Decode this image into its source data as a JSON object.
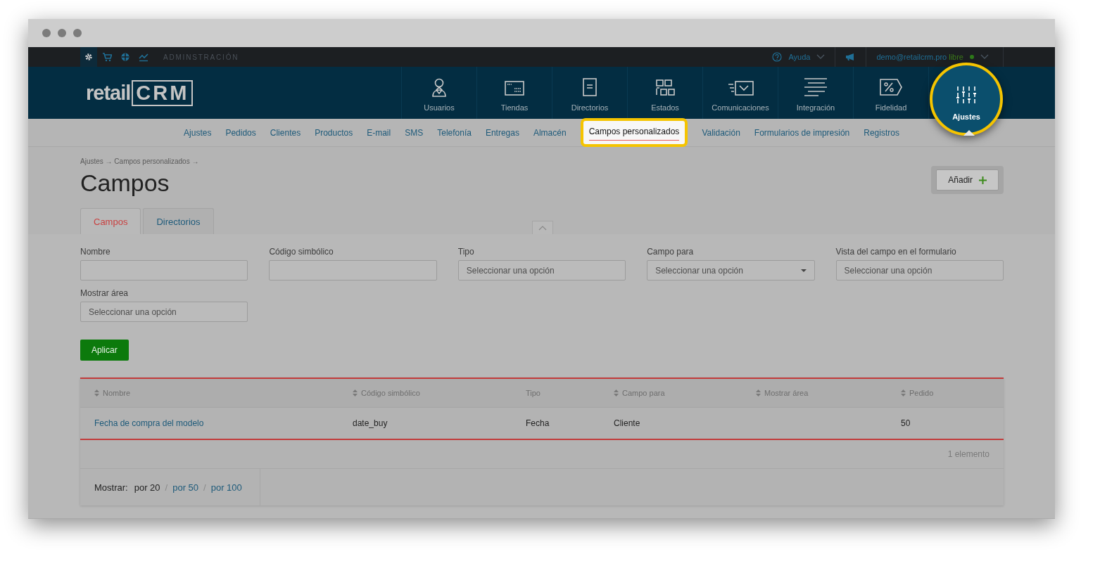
{
  "window": {
    "controls": [
      {
        "kind": "dot"
      },
      {
        "kind": "dot"
      },
      {
        "kind": "dot"
      }
    ]
  },
  "top_bar": {
    "icons": [
      {
        "kind": "gear",
        "selected": true
      },
      {
        "kind": "cart",
        "selected": false
      },
      {
        "kind": "target",
        "selected": false
      },
      {
        "kind": "chart",
        "selected": false
      }
    ],
    "section": "ADMINSTRACIÓN",
    "help": "Ayuda",
    "user": "demo@retailcrm.pro",
    "plan": "libre"
  },
  "logo": {
    "part_1": "retail",
    "part_2": "CRM"
  },
  "main_nav": [
    {
      "label": "Usuarios",
      "kind": "user",
      "selected": false
    },
    {
      "label": "Tiendas",
      "kind": "window",
      "selected": false
    },
    {
      "label": "Directorios",
      "kind": "doc",
      "selected": false
    },
    {
      "label": "Estados",
      "kind": "grid",
      "selected": false
    },
    {
      "label": "Comunicaciones",
      "kind": "mail",
      "selected": false
    },
    {
      "label": "Integración",
      "kind": "lines",
      "selected": false
    },
    {
      "label": "Fidelidad",
      "kind": "percent",
      "selected": false
    },
    {
      "label": "Ajustes",
      "kind": "sliders",
      "selected": true
    }
  ],
  "sub_nav": [
    {
      "label": "Ajustes",
      "selected": false
    },
    {
      "label": "Pedidos",
      "selected": false
    },
    {
      "label": "Clientes",
      "selected": false
    },
    {
      "label": "Productos",
      "selected": false
    },
    {
      "label": "E-mail",
      "selected": false
    },
    {
      "label": "SMS",
      "selected": false
    },
    {
      "label": "Telefonía",
      "selected": false
    },
    {
      "label": "Entregas",
      "selected": false
    },
    {
      "label": "Almacén",
      "selected": false
    },
    {
      "label": "Campos personalizados",
      "selected": true
    },
    {
      "label": "Validación",
      "selected": false
    },
    {
      "label": "Formularios de impresión",
      "selected": false
    },
    {
      "label": "Registros",
      "selected": false
    }
  ],
  "breadcrumb": "Ajustes → Campos personalizados →",
  "title": "Campos",
  "add_button": "Añadir",
  "tabs": [
    {
      "label": "Campos",
      "selected": true
    },
    {
      "label": "Directorios",
      "selected": false
    }
  ],
  "filters": [
    {
      "label": "Nombre",
      "kind": "text"
    },
    {
      "label": "Código simbólico",
      "kind": "text"
    },
    {
      "label": "Tipo",
      "kind": "select",
      "placeholder": "Seleccionar una opción"
    },
    {
      "label": "Campo para",
      "kind": "dropdown",
      "placeholder": "Seleccionar una opción"
    },
    {
      "label": "Vista del campo en el formulario",
      "kind": "select",
      "placeholder": "Seleccionar una opción"
    },
    {
      "label": "Mostrar área",
      "kind": "select",
      "placeholder": "Seleccionar una opción"
    }
  ],
  "apply_button": "Aplicar",
  "table": {
    "columns": [
      {
        "label": "Nombre",
        "sortable": true
      },
      {
        "label": "Código simbólico",
        "sortable": true
      },
      {
        "label": "Tipo",
        "sortable": false
      },
      {
        "label": "Campo para",
        "sortable": true
      },
      {
        "label": "Mostrar área",
        "sortable": true
      },
      {
        "label": "Pedido",
        "sortable": true
      }
    ],
    "rows": [
      {
        "cells": [
          "Fecha de compra del modelo",
          "date_buy",
          "Fecha",
          "Cliente",
          "",
          "50"
        ]
      }
    ],
    "count": "1 elemento"
  },
  "pagination": {
    "label": "Mostrar:",
    "separators": [
      "/",
      "/"
    ],
    "options": [
      {
        "label": "por 20",
        "selected": true
      },
      {
        "label": "por 50",
        "selected": false
      },
      {
        "label": "por 100",
        "selected": false
      }
    ]
  }
}
